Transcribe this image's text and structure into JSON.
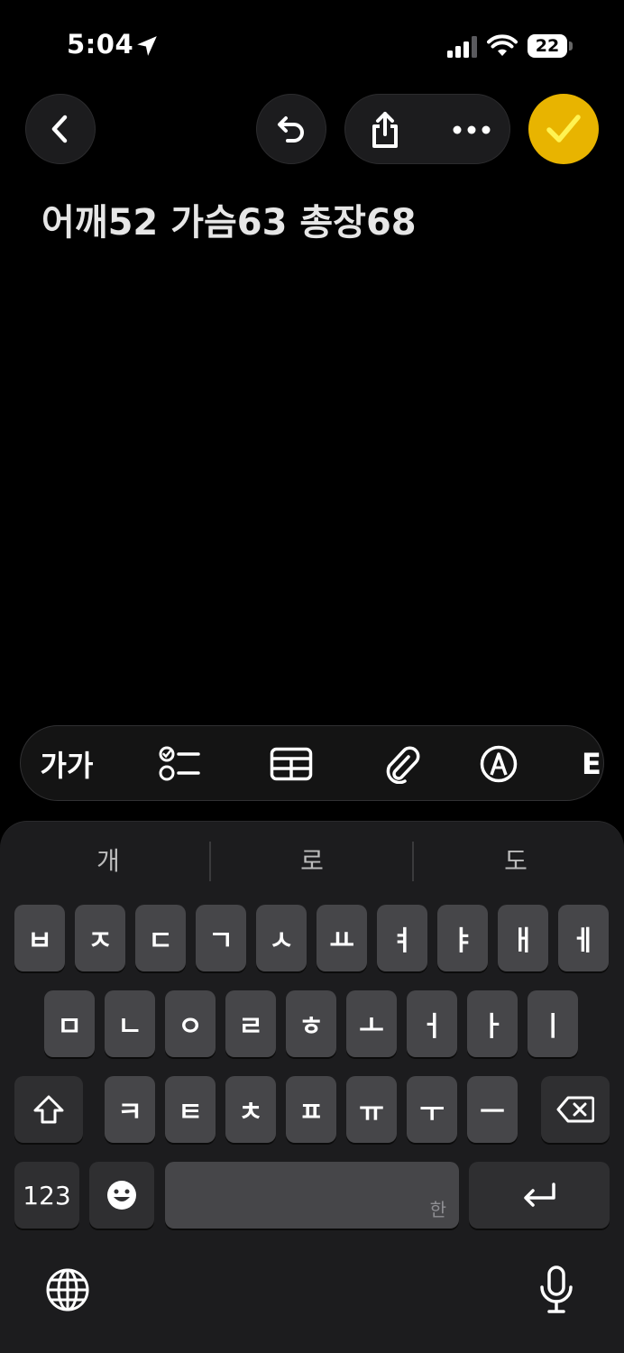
{
  "status_bar": {
    "time": "5:04",
    "battery_level": "22",
    "icons": [
      "location-arrow-icon",
      "cellular-signal-icon",
      "wifi-icon",
      "battery-icon"
    ]
  },
  "toolbar": {
    "icons": [
      "back-chevron-icon",
      "undo-icon",
      "share-icon",
      "more-icon",
      "checkmark-icon"
    ],
    "accent_color": "#e8b400"
  },
  "note": {
    "text": "어깨52 가슴63 총장68"
  },
  "format_bar": {
    "text_style_label": "가가",
    "icons": [
      "checklist-icon",
      "table-icon",
      "paperclip-icon",
      "markup-pen-icon"
    ],
    "partial_item": "E"
  },
  "keyboard": {
    "suggestions": [
      "개",
      "로",
      "도"
    ],
    "row1": [
      "ㅂ",
      "ㅈ",
      "ㄷ",
      "ㄱ",
      "ㅅ",
      "ㅛ",
      "ㅕ",
      "ㅑ",
      "ㅐ",
      "ㅔ"
    ],
    "row2": [
      "ㅁ",
      "ㄴ",
      "ㅇ",
      "ㄹ",
      "ㅎ",
      "ㅗ",
      "ㅓ",
      "ㅏ",
      "ㅣ"
    ],
    "row3": [
      "ㅋ",
      "ㅌ",
      "ㅊ",
      "ㅍ",
      "ㅠ",
      "ㅜ",
      "ㅡ"
    ],
    "numbers_label": "123",
    "space_sub_label": "한",
    "icons": [
      "shift-icon",
      "delete-icon",
      "emoji-icon",
      "return-icon",
      "globe-icon",
      "microphone-icon"
    ]
  }
}
